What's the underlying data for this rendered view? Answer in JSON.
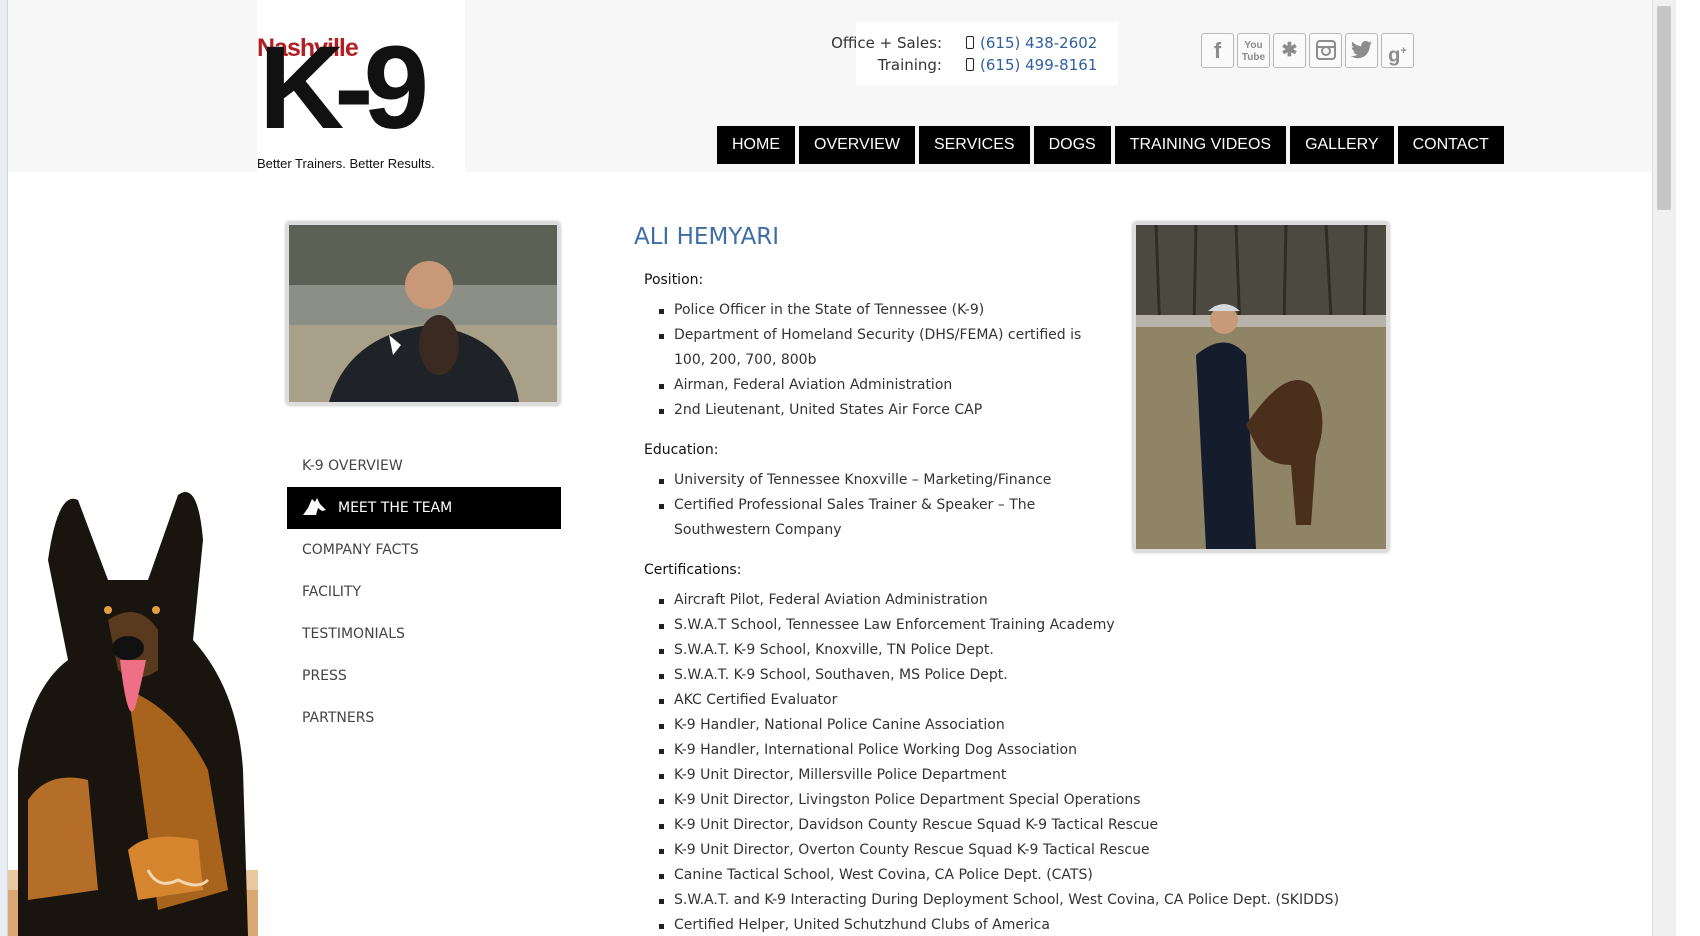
{
  "logo": {
    "brand": "Nashville",
    "mark": "K-9",
    "tagline": "Better Trainers. Better Results."
  },
  "contact": {
    "office_label": "Office + Sales:",
    "office_phone": "(615) 438-2602",
    "training_label": "Training:",
    "training_phone": "(615) 499-8161"
  },
  "social": [
    {
      "icon": "facebook-icon",
      "glyph": "f"
    },
    {
      "icon": "youtube-icon",
      "glyph": "You Tube"
    },
    {
      "icon": "yelp-icon",
      "glyph": "✱"
    },
    {
      "icon": "instagram-icon",
      "glyph": "◙"
    },
    {
      "icon": "twitter-icon",
      "glyph": "🐦"
    },
    {
      "icon": "google-plus-icon",
      "glyph": "g+"
    }
  ],
  "nav": [
    "HOME",
    "OVERVIEW",
    "SERVICES",
    "DOGS",
    "TRAINING VIDEOS",
    "GALLERY",
    "CONTACT"
  ],
  "sidenav": [
    "K-9 OVERVIEW",
    "MEET THE TEAM",
    "COMPANY FACTS",
    "FACILITY",
    "TESTIMONIALS",
    "PRESS",
    "PARTNERS"
  ],
  "sidenav_active": "MEET THE TEAM",
  "profile": {
    "name": "ALI HEMYARI",
    "position_heading": "Position:",
    "position": [
      "Police Officer in the State of Tennessee (K-9)",
      "Department of Homeland Security (DHS/FEMA) certified is 100, 200, 700, 800b",
      "Airman, Federal Aviation Administration",
      "2nd Lieutenant, United States Air Force CAP"
    ],
    "education_heading": "Education:",
    "education": [
      "University of Tennessee Knoxville – Marketing/Finance",
      "Certified Professional Sales Trainer & Speaker – The Southwestern Company"
    ],
    "certifications_heading": "Certifications:",
    "certifications": [
      "Aircraft Pilot, Federal Aviation Administration",
      "S.W.A.T School, Tennessee Law Enforcement Training Academy",
      "S.W.A.T. K-9 School, Knoxville, TN Police Dept.",
      "S.W.A.T. K-9 School, Southaven, MS Police Dept.",
      "AKC Certified Evaluator",
      "K-9 Handler, National Police Canine Association",
      "K-9 Handler, International Police Working Dog Association",
      "K-9 Unit Director, Millersville Police Department",
      "K-9 Unit Director, Livingston Police Department Special Operations",
      "K-9 Unit Director, Davidson County Rescue Squad K-9 Tactical Rescue",
      "K-9 Unit Director, Overton County Rescue Squad K-9 Tactical Rescue",
      "Canine Tactical School, West Covina, CA Police Dept. (CATS)",
      "S.W.A.T. and K-9 Interacting During Deployment School, West Covina, CA Police Dept. (SKIDDS)",
      "Certified Helper, United Schutzhund Clubs of America"
    ]
  },
  "colors": {
    "accent": "#3d6ea5",
    "brand_red": "#b21f24",
    "nav_bg": "#000000",
    "link": "#2f5f9e"
  }
}
